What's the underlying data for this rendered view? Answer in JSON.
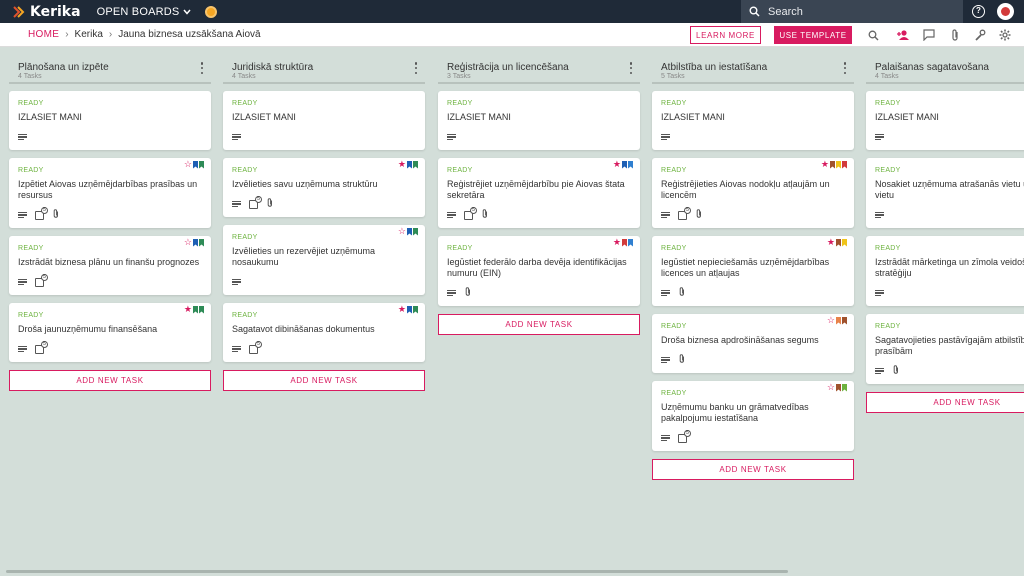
{
  "app": {
    "name": "Kerika",
    "open_boards": "OPEN BOARDS"
  },
  "search": {
    "placeholder": "Search"
  },
  "breadcrumb": {
    "home": "HOME",
    "workspace": "Kerika",
    "board": "Jauna biznesa uzsākšana Aiovā"
  },
  "toolbar": {
    "learn_more": "LEARN MORE",
    "use_template": "USE TEMPLATE"
  },
  "colors": {
    "accent": "#d81b60",
    "topbar": "#1f2a38",
    "board_bg": "#d3ded9",
    "ready": "#6db33f"
  },
  "add_task_label": "ADD NEW TASK",
  "columns": [
    {
      "title": "Plānošana un izpēte",
      "count": "4 Tasks",
      "cards": [
        {
          "status": "READY",
          "title": "IZLASIET MANI",
          "star": "",
          "flags": [],
          "check": "",
          "clip": false
        },
        {
          "status": "READY",
          "title": "Izpētiet Aiovas uzņēmējdarbības prasības un resursus",
          "star": "☆",
          "flags": [
            "#1e5fb4",
            "#2e8b57"
          ],
          "check": "5",
          "clip": true
        },
        {
          "status": "READY",
          "title": "Izstrādāt biznesa plānu un finanšu prognozes",
          "star": "☆",
          "flags": [
            "#1e5fb4",
            "#2e8b57"
          ],
          "check": "5",
          "clip": false
        },
        {
          "status": "READY",
          "title": "Droša jaunuzņēmumu finansēšana",
          "star": "★",
          "flags": [
            "#2e8b57",
            "#2e8b57"
          ],
          "check": "5",
          "clip": false
        }
      ]
    },
    {
      "title": "Juridiskā struktūra",
      "count": "4 Tasks",
      "cards": [
        {
          "status": "READY",
          "title": "IZLASIET MANI",
          "star": "",
          "flags": [],
          "check": "",
          "clip": false
        },
        {
          "status": "READY",
          "title": "Izvēlieties savu uzņēmuma struktūru",
          "star": "★",
          "flags": [
            "#1e5fb4",
            "#2e8b57"
          ],
          "check": "5",
          "clip": true
        },
        {
          "status": "READY",
          "title": "Izvēlieties un rezervējiet uzņēmuma nosaukumu",
          "star": "☆",
          "flags": [
            "#1e5fb4",
            "#2e8b57"
          ],
          "check": "",
          "clip": false
        },
        {
          "status": "READY",
          "title": "Sagatavot dibināšanas dokumentus",
          "star": "★",
          "flags": [
            "#1e5fb4",
            "#2e8b57"
          ],
          "check": "5",
          "clip": false
        }
      ]
    },
    {
      "title": "Reģistrācija un licencēšana",
      "count": "3 Tasks",
      "cards": [
        {
          "status": "READY",
          "title": "IZLASIET MANI",
          "star": "",
          "flags": [],
          "check": "",
          "clip": false
        },
        {
          "status": "READY",
          "title": "Reģistrējiet uzņēmējdarbību pie Aiovas štata sekretāra",
          "star": "★",
          "flags": [
            "#1e5fb4",
            "#2f7fd0"
          ],
          "check": "5",
          "clip": true
        },
        {
          "status": "READY",
          "title": "Iegūstiet federālo darba devēja identifikācijas numuru (EIN)",
          "star": "★",
          "flags": [
            "#d23b3b",
            "#2f7fd0"
          ],
          "check": "",
          "clip": true
        }
      ]
    },
    {
      "title": "Atbilstība un iestatīšana",
      "count": "5 Tasks",
      "cards": [
        {
          "status": "READY",
          "title": "IZLASIET MANI",
          "star": "",
          "flags": [],
          "check": "",
          "clip": false
        },
        {
          "status": "READY",
          "title": "Reģistrējieties Aiovas nodokļu atļaujām un licencēm",
          "star": "★",
          "flags": [
            "#a0522d",
            "#f0c419",
            "#d23b3b"
          ],
          "check": "5",
          "clip": true
        },
        {
          "status": "READY",
          "title": "Iegūstiet nepieciešamās uzņēmējdarbības licences un atļaujas",
          "star": "★",
          "flags": [
            "#a0522d",
            "#f0c419"
          ],
          "check": "",
          "clip": true
        },
        {
          "status": "READY",
          "title": "Droša biznesa apdrošināšanas segums",
          "star": "☆",
          "flags": [
            "#e8834a",
            "#a0522d"
          ],
          "check": "",
          "clip": true
        },
        {
          "status": "READY",
          "title": "Uzņēmumu banku un grāmatvedības pakalpojumu iestatīšana",
          "star": "☆",
          "flags": [
            "#a0522d",
            "#6db33f"
          ],
          "check": "5",
          "clip": false
        }
      ]
    },
    {
      "title": "Palaišanas sagatavošana",
      "count": "4 Tasks",
      "cards": [
        {
          "status": "READY",
          "title": "IZLASIET MANI",
          "star": "",
          "flags": [],
          "check": "",
          "clip": false
        },
        {
          "status": "READY",
          "title": "Nosakiet uzņēmuma atrašanās vietu un d vietu",
          "star": "",
          "flags": [],
          "check": "",
          "clip": false
        },
        {
          "status": "READY",
          "title": "Izstrādāt mārketinga un zīmola veidošan stratēģiju",
          "star": "",
          "flags": [],
          "check": "",
          "clip": false
        },
        {
          "status": "READY",
          "title": "Sagatavojieties pastāvīgajām atbilstības prasībām",
          "star": "",
          "flags": [],
          "check": "",
          "clip": true
        }
      ]
    }
  ]
}
